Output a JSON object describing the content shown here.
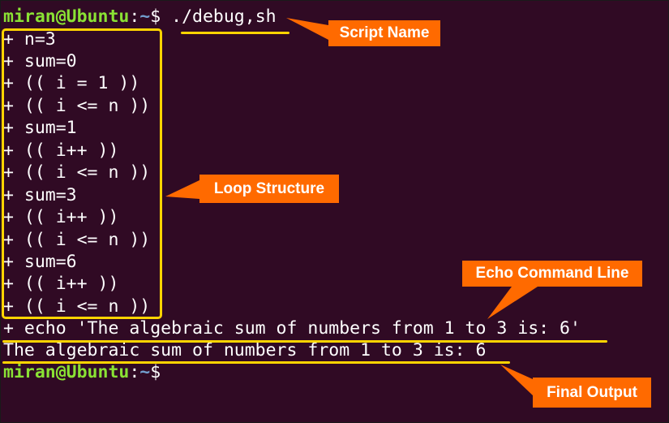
{
  "terminal": {
    "prompt": {
      "user_host": "miran@Ubuntu",
      "separator": ":",
      "path": "~",
      "symbol": "$ "
    },
    "command": "./debug,sh",
    "trace_lines": [
      "+ n=3",
      "+ sum=0",
      "+ (( i = 1 ))",
      "+ (( i <= n ))",
      "+ sum=1",
      "+ (( i++ ))",
      "+ (( i <= n ))",
      "+ sum=3",
      "+ (( i++ ))",
      "+ (( i <= n ))",
      "+ sum=6",
      "+ (( i++ ))",
      "+ (( i <= n ))"
    ],
    "echo_line": "+ echo 'The algebraic sum of numbers from 1 to 3 is: 6'",
    "output_line": "The algebraic sum of numbers from 1 to 3 is: 6"
  },
  "annotations": {
    "script_name": "Script Name",
    "loop_structure": "Loop Structure",
    "echo_command_line": "Echo Command Line",
    "final_output": "Final Output"
  },
  "colors": {
    "background": "#300a24",
    "prompt_user": "#8ae234",
    "prompt_path": "#729fcf",
    "highlight": "#ffd400",
    "callout": "#ff6a00"
  }
}
